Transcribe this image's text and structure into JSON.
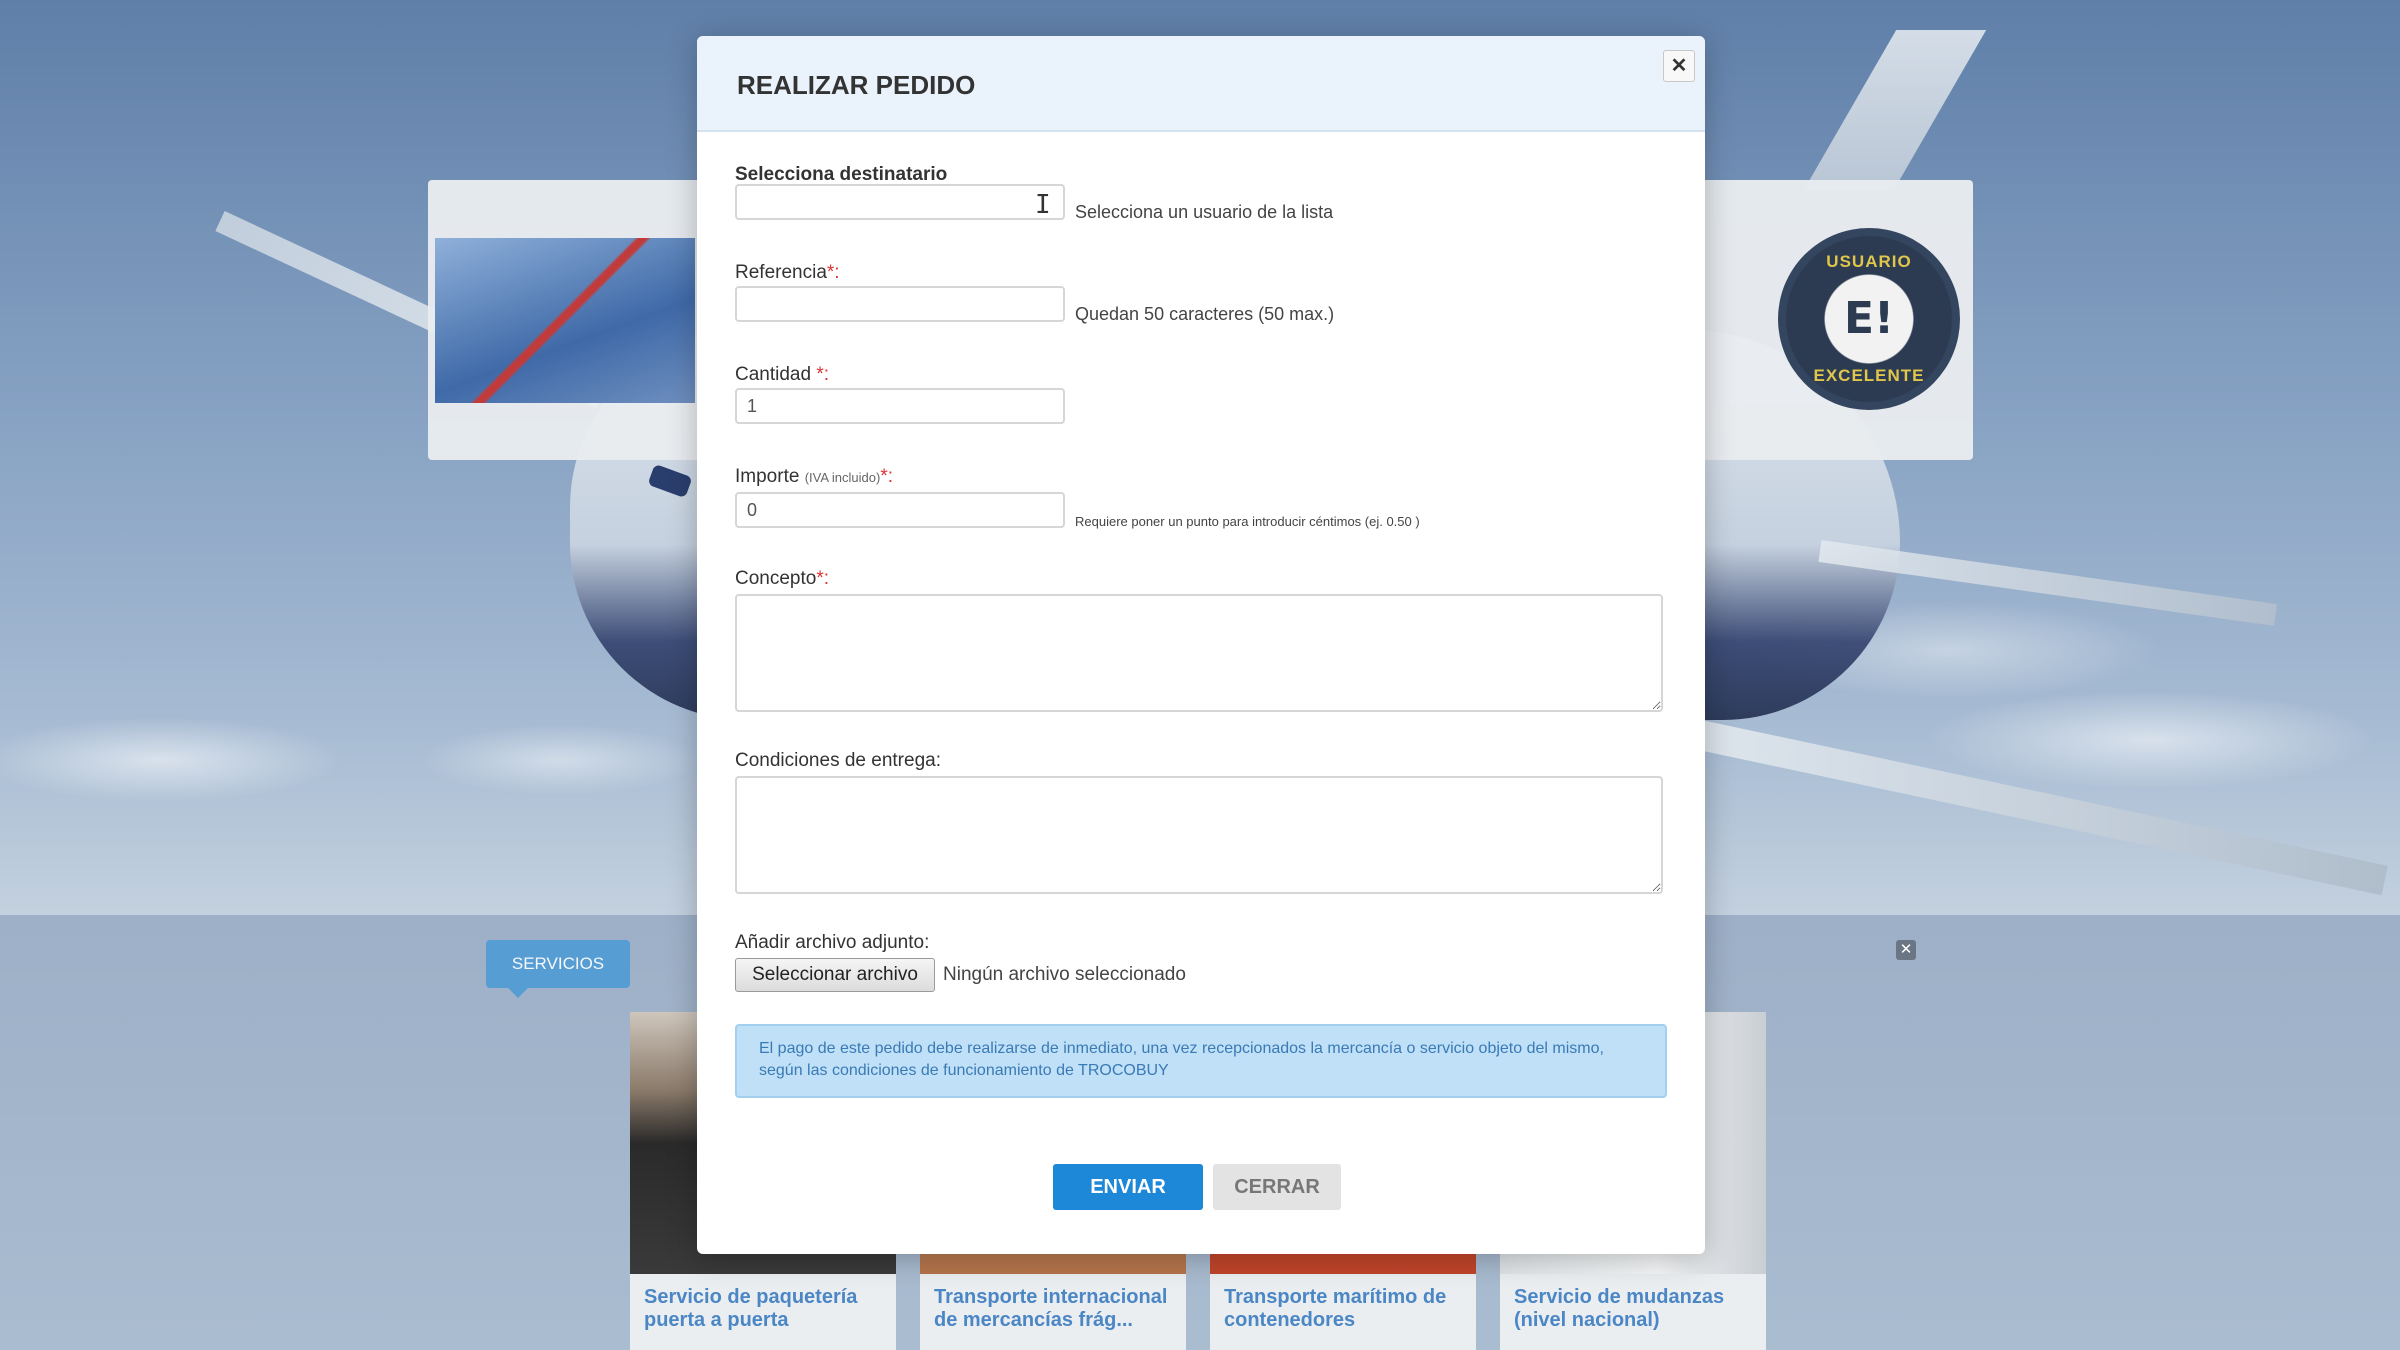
{
  "background": {
    "badge": {
      "top_text": "USUARIO",
      "center_text": "E!",
      "bottom_text": "EXCELENTE"
    },
    "servicios_tab": "SERVICIOS",
    "close_icon": "close-icon",
    "services": [
      {
        "title": "Servicio de paquetería puerta a puerta"
      },
      {
        "title": "Transporte internacional de mercancías frág..."
      },
      {
        "title": "Transporte marítimo de contenedores"
      },
      {
        "title": "Servicio de mudanzas (nivel nacional)"
      }
    ]
  },
  "modal": {
    "title": "REALIZAR PEDIDO",
    "close_icon": "close-icon",
    "fields": {
      "destinatario": {
        "label": "Selecciona destinatario",
        "value": "",
        "hint": "Selecciona un usuario de la lista"
      },
      "referencia": {
        "label": "Referencia",
        "required": "*:",
        "value": "",
        "hint": "Quedan 50 caracteres (50 max.)"
      },
      "cantidad": {
        "label": "Cantidad",
        "required": "*:",
        "value": "1"
      },
      "importe": {
        "label": "Importe",
        "note": "(IVA incluido)",
        "required": "*:",
        "value": "0",
        "hint": "Requiere poner un punto para introducir céntimos (ej. 0.50 )"
      },
      "concepto": {
        "label": "Concepto",
        "required": "*:"
      },
      "condiciones": {
        "label": "Condiciones de entrega:"
      },
      "archivo": {
        "label": "Añadir archivo adjunto:",
        "button": "Seleccionar archivo",
        "status": "Ningún archivo seleccionado"
      }
    },
    "info": "El pago de este pedido debe realizarse de inmediato, una vez recepcionados la mercancía o servicio objeto del mismo, según las condiciones de funcionamiento de TROCOBUY",
    "buttons": {
      "submit": "ENVIAR",
      "close": "CERRAR"
    }
  },
  "colors": {
    "accent": "#1d87d8",
    "info_bg": "#bfe0f7",
    "info_text": "#3a7ab5",
    "required": "#dd3333"
  }
}
